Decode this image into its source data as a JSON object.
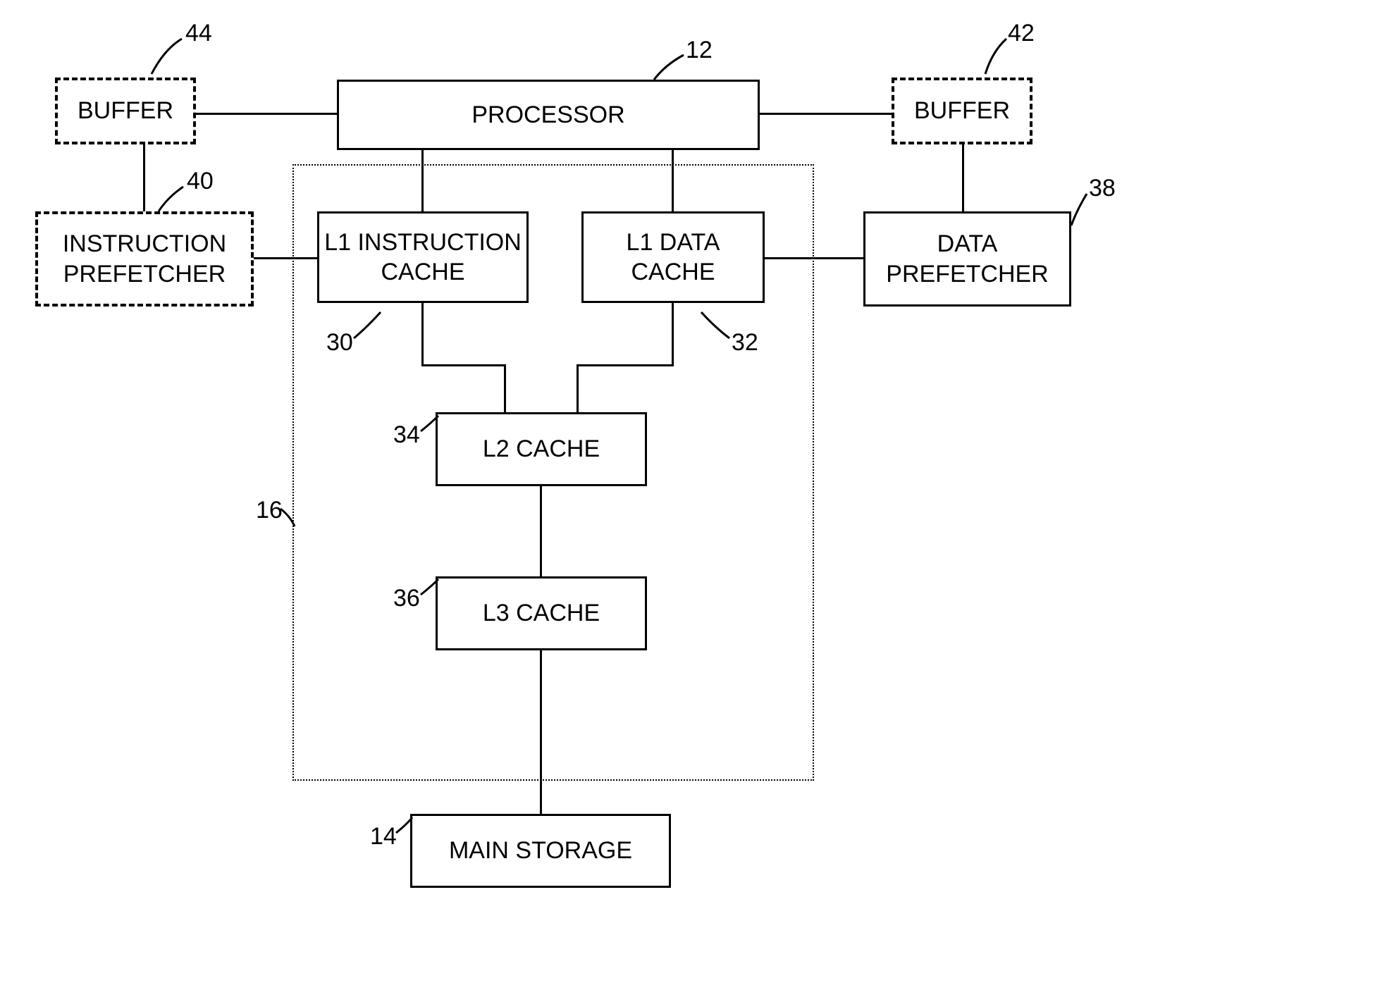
{
  "refs": {
    "processor": "12",
    "mainStorage": "14",
    "cacheGroup": "16",
    "l1Instr": "30",
    "l1Data": "32",
    "l2": "34",
    "l3": "36",
    "dataPrefetcher": "38",
    "instrPrefetcher": "40",
    "bufferRight": "42",
    "bufferLeft": "44"
  },
  "labels": {
    "processor": "PROCESSOR",
    "bufferLeft": "BUFFER",
    "bufferRight": "BUFFER",
    "instrPrefetcher": "INSTRUCTION\nPREFETCHER",
    "dataPrefetcher": "DATA\nPREFETCHER",
    "l1Instr": "L1 INSTRUCTION\nCACHE",
    "l1Data": "L1 DATA\nCACHE",
    "l2": "L2 CACHE",
    "l3": "L3 CACHE",
    "mainStorage": "MAIN STORAGE"
  }
}
